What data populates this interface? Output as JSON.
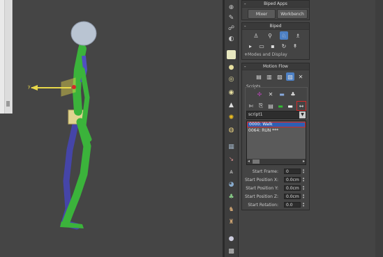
{
  "biped_apps": {
    "title": "Biped Apps",
    "mixer_label": "Mixer",
    "workbench_label": "Workbench"
  },
  "biped": {
    "title": "Biped",
    "modes_label": "Modes and Display"
  },
  "motion_flow": {
    "title": "Motion Flow",
    "scripts_label": "Scripts",
    "script_select_value": "script1",
    "clips": [
      "0000: Walk",
      "0064: RUN ***"
    ],
    "fields": [
      {
        "label": "Start Frame:",
        "value": "0"
      },
      {
        "label": "Start Position X:",
        "value": "0.0cm"
      },
      {
        "label": "Start Position Y:",
        "value": "0.0cm"
      },
      {
        "label": "Start Position Z:",
        "value": "0.0cm"
      },
      {
        "label": "Start Rotation:",
        "value": "0.0"
      }
    ]
  },
  "colors": {
    "selection_blue": "#4d80c4",
    "highlight_red": "#d42a2a",
    "leg_green": "#3bb33b",
    "body_blue": "#4b4bb0",
    "gizmo_yellow": "#e8d84a"
  }
}
